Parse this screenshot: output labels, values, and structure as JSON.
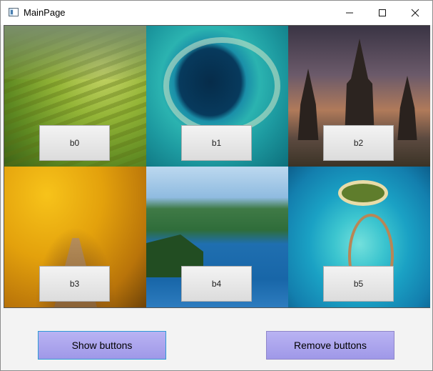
{
  "window": {
    "title": "MainPage"
  },
  "title_bar_controls": {
    "minimize_icon": "minimize-icon",
    "maximize_icon": "maximize-icon",
    "close_icon": "close-icon"
  },
  "tiles": [
    {
      "button_label": "b0",
      "image": "rice-terraces"
    },
    {
      "button_label": "b1",
      "image": "blue-hole"
    },
    {
      "button_label": "b2",
      "image": "temple-sunset"
    },
    {
      "button_label": "b3",
      "image": "autumn-path"
    },
    {
      "button_label": "b4",
      "image": "lake-mountains"
    },
    {
      "button_label": "b5",
      "image": "atoll-resort"
    }
  ],
  "actions": {
    "show_label": "Show buttons",
    "remove_label": "Remove buttons"
  },
  "colors": {
    "action_button": "#a9a3ee",
    "show_button_border": "#2f9ad6",
    "window_background": "#f3f3f3"
  }
}
